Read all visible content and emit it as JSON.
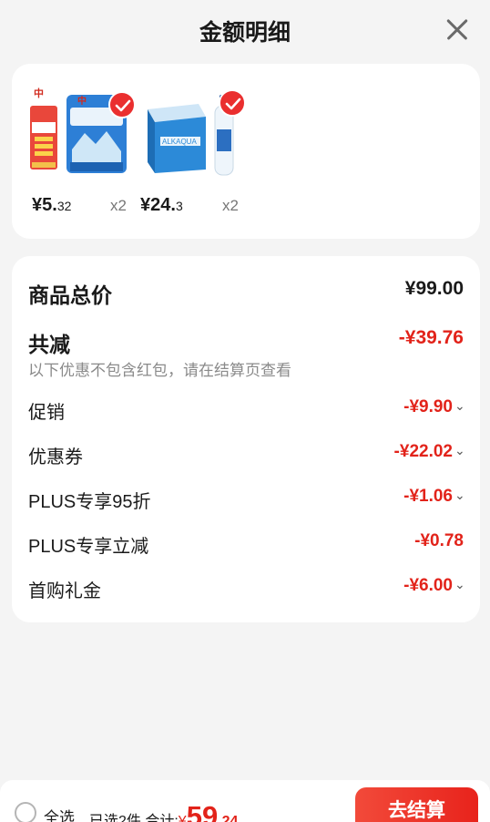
{
  "header": {
    "title": "金额明细"
  },
  "products": [
    {
      "price_int": "¥5.",
      "price_dec": "32",
      "qty": "x2",
      "thumb_desc": "tianshan-water-bag-icon"
    },
    {
      "price_int": "¥24.",
      "price_dec": "3",
      "qty": "x2",
      "thumb_desc": "alkaqua-water-box-icon"
    }
  ],
  "detail": {
    "total_label": "商品总价",
    "total_value": "¥99.00",
    "reduce_label": "共减",
    "reduce_value": "-¥39.76",
    "reduce_note": "以下优惠不包含红包，请在结算页查看",
    "items": [
      {
        "label": "促销",
        "value": "-¥9.90",
        "expand": true
      },
      {
        "label": "优惠券",
        "value": "-¥22.02",
        "expand": true
      },
      {
        "label": "PLUS专享95折",
        "value": "-¥1.06",
        "expand": true
      },
      {
        "label": "PLUS专享立减",
        "value": "-¥0.78",
        "expand": false
      },
      {
        "label": "首购礼金",
        "value": "-¥6.00",
        "expand": true
      }
    ]
  },
  "bottom": {
    "select_all": "全选",
    "summary_prefix": "已选2件,合计:",
    "currency": "¥",
    "amount_int": "59",
    "amount_dec": ".24",
    "checkout": "去结算"
  },
  "colors": {
    "accent": "#e2231a",
    "button": "#ec2f23",
    "check": "#ea2f2f"
  }
}
